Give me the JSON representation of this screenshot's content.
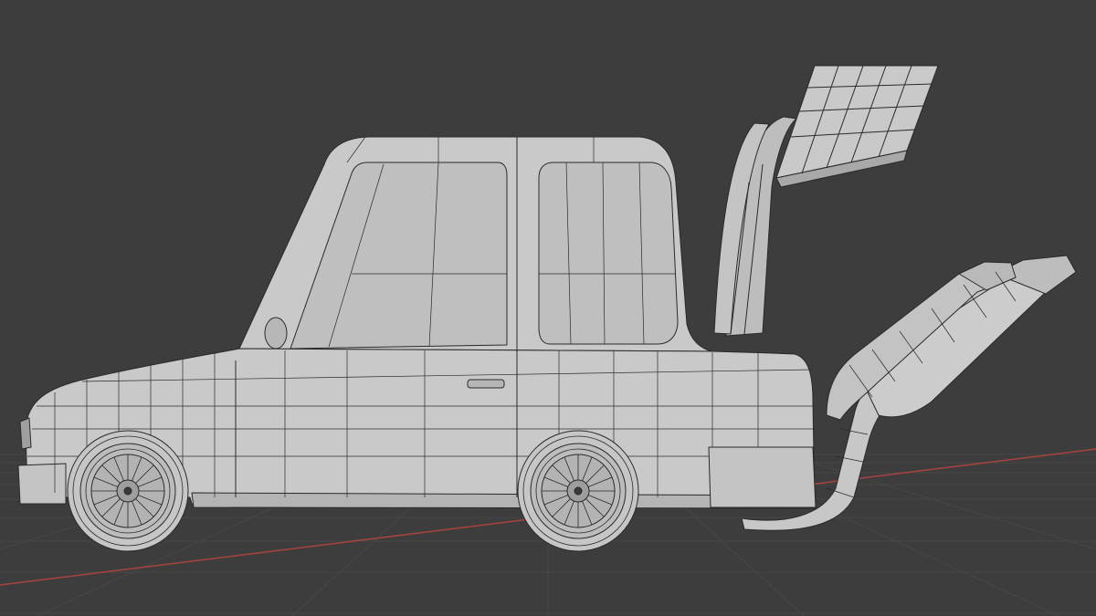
{
  "viewport": {
    "view": "side-orthographic",
    "shading": "solid-wireframe",
    "background_color": "#3d3d3d",
    "grid_color": "#474747",
    "x_axis_color": "#a8433f",
    "mesh_color": "#c9c9c9",
    "wire_color": "#2a2a2a"
  },
  "scene_object": {
    "icon": "car-mesh-icon",
    "parts": [
      "body",
      "cabin",
      "front-wheel",
      "rear-wheel",
      "rear-wing",
      "exhaust-pipes",
      "side-mirror",
      "door-handle",
      "front-bumper",
      "rear-bumper"
    ]
  }
}
